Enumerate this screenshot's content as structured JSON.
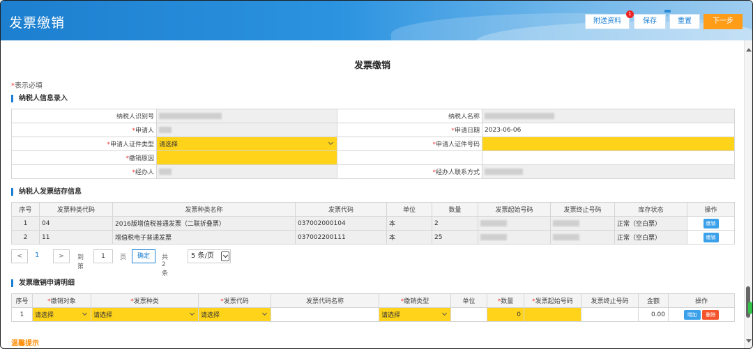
{
  "header": {
    "title": "发票缴销",
    "buttons": {
      "attach": "附送资料",
      "save": "保存",
      "reset": "重置",
      "next": "下一步"
    },
    "attach_badge": "1"
  },
  "page": {
    "title": "发票缴销",
    "required_star": "*",
    "required_note": "表示必填"
  },
  "sections": {
    "taxpayer": "纳税人信息录入",
    "stock": "纳税人发票结存信息",
    "detail": "发票缴销申请明细",
    "tip": "温馨提示"
  },
  "taxpayer_form": {
    "taxpayer_id_label": "纳税人识别号",
    "taxpayer_name_label": "纳税人名称",
    "applicant_label": "申请人",
    "apply_date_label": "申请日期",
    "apply_date_value": "2023-06-06",
    "cert_type_label": "申请人证件类型",
    "cert_type_value": "请选择",
    "cert_no_label": "申请人证件号码",
    "reason_label": "缴销原因",
    "handler_label": "经办人",
    "handler_contact_label": "经办人联系方式"
  },
  "stock_table": {
    "headers": [
      "序号",
      "发票种类代码",
      "发票种类名称",
      "发票代码",
      "单位",
      "数量",
      "发票起始号码",
      "发票终止号码",
      "库存状态",
      "操作"
    ],
    "rows": [
      {
        "no": "1",
        "type_code": "04",
        "type_name": "2016版增值税普通发票（二联折叠票）",
        "code": "037002000104",
        "unit": "本",
        "qty": "2",
        "status": "正常（空白票）",
        "action": "缴销"
      },
      {
        "no": "2",
        "type_code": "11",
        "type_name": "增值税电子普通发票",
        "code": "037002200111",
        "unit": "本",
        "qty": "25",
        "status": "正常（空白票）",
        "action": "缴销"
      }
    ]
  },
  "pager": {
    "prev": "<",
    "current": "1",
    "next": ">",
    "goto_label": "到第",
    "page_input": "1",
    "page_unit": "页",
    "confirm": "确定",
    "total": "共 2 条",
    "page_size": "5 条/页"
  },
  "detail_table": {
    "headers": [
      "序号",
      "缴销对象",
      "发票种类",
      "发票代码",
      "发票代码名称",
      "缴销类型",
      "单位",
      "数量",
      "发票起始号码",
      "发票终止号码",
      "金额",
      "操作"
    ],
    "required_cols": [
      1,
      2,
      3,
      5,
      7,
      8
    ],
    "row": {
      "no": "1",
      "target": "请选择",
      "type": "请选择",
      "code": "请选择",
      "cancel_type": "请选择",
      "qty": "0",
      "amount": "0.00",
      "add": "增加",
      "delete": "删除"
    }
  },
  "colors": {
    "header_blue": "#1d7fcf",
    "required_yellow": "#ffd31a",
    "next_orange": "#ff9c18",
    "action_blue": "#3aa0ea",
    "delete_red": "#f4552c"
  }
}
